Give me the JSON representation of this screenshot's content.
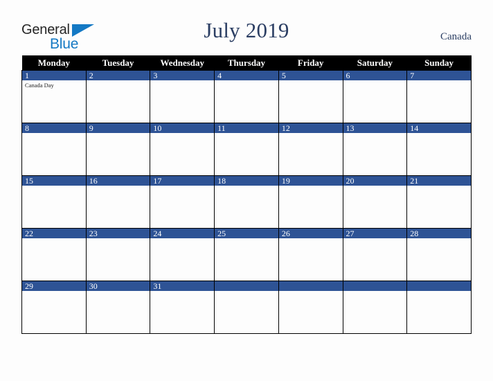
{
  "brand": {
    "name_part1": "General",
    "name_part2": "Blue",
    "triangle_icon": "blue-triangle-icon",
    "color_dark": "#262626",
    "color_blue": "#1479c4"
  },
  "header": {
    "title": "July 2019",
    "country": "Canada",
    "title_color": "#2b3e63"
  },
  "calendar": {
    "weekday_headers": [
      "Monday",
      "Tuesday",
      "Wednesday",
      "Thursday",
      "Friday",
      "Saturday",
      "Sunday"
    ],
    "header_bg": "#000000",
    "header_fg": "#ffffff",
    "daynum_band_color": "#2e5395",
    "cell_bg": "#fdfdfd",
    "grid_line_color": "#000000",
    "weeks": [
      [
        {
          "day": "1",
          "events": [
            "Canada Day"
          ]
        },
        {
          "day": "2",
          "events": []
        },
        {
          "day": "3",
          "events": []
        },
        {
          "day": "4",
          "events": []
        },
        {
          "day": "5",
          "events": []
        },
        {
          "day": "6",
          "events": []
        },
        {
          "day": "7",
          "events": []
        }
      ],
      [
        {
          "day": "8",
          "events": []
        },
        {
          "day": "9",
          "events": []
        },
        {
          "day": "10",
          "events": []
        },
        {
          "day": "11",
          "events": []
        },
        {
          "day": "12",
          "events": []
        },
        {
          "day": "13",
          "events": []
        },
        {
          "day": "14",
          "events": []
        }
      ],
      [
        {
          "day": "15",
          "events": []
        },
        {
          "day": "16",
          "events": []
        },
        {
          "day": "17",
          "events": []
        },
        {
          "day": "18",
          "events": []
        },
        {
          "day": "19",
          "events": []
        },
        {
          "day": "20",
          "events": []
        },
        {
          "day": "21",
          "events": []
        }
      ],
      [
        {
          "day": "22",
          "events": []
        },
        {
          "day": "23",
          "events": []
        },
        {
          "day": "24",
          "events": []
        },
        {
          "day": "25",
          "events": []
        },
        {
          "day": "26",
          "events": []
        },
        {
          "day": "27",
          "events": []
        },
        {
          "day": "28",
          "events": []
        }
      ],
      [
        {
          "day": "29",
          "events": []
        },
        {
          "day": "30",
          "events": []
        },
        {
          "day": "31",
          "events": []
        },
        {
          "day": "",
          "events": []
        },
        {
          "day": "",
          "events": []
        },
        {
          "day": "",
          "events": []
        },
        {
          "day": "",
          "events": []
        }
      ]
    ]
  }
}
